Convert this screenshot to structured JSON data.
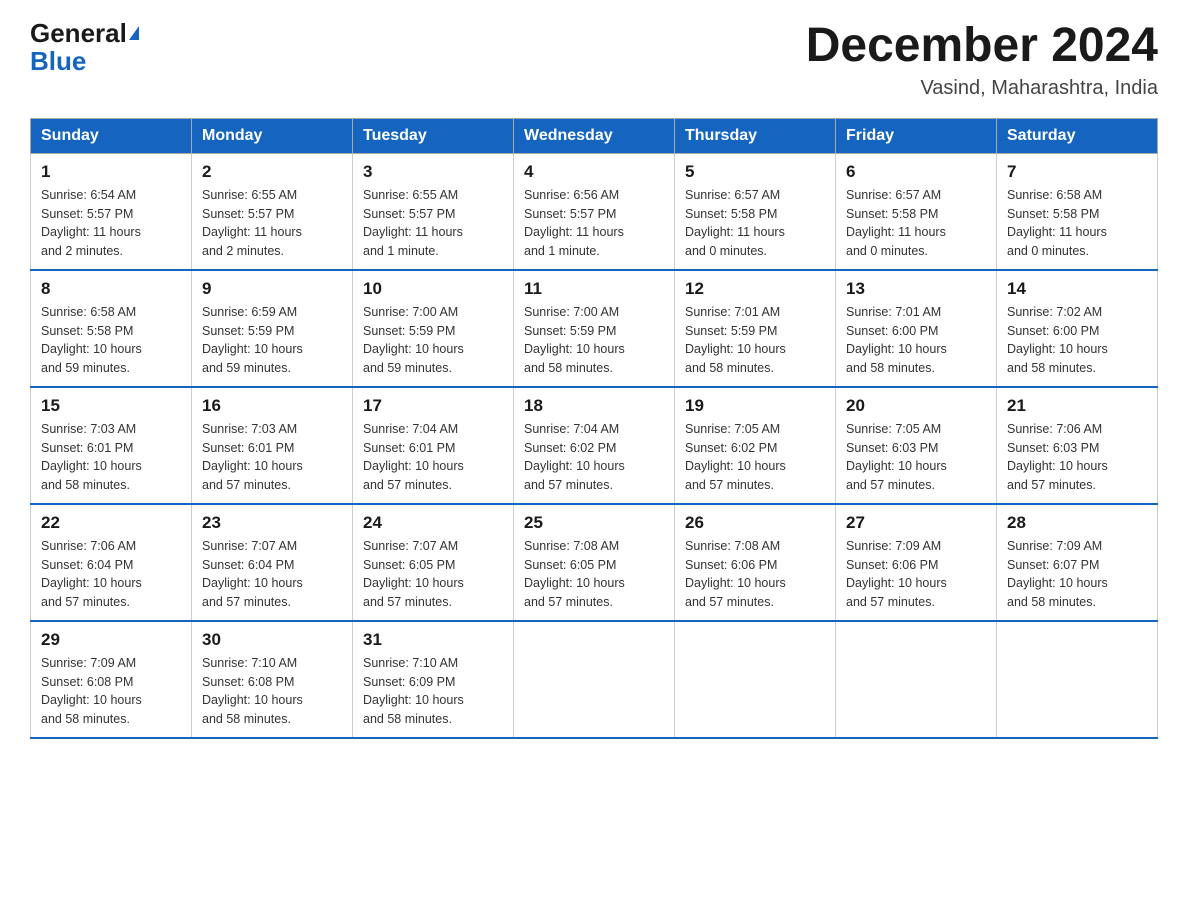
{
  "logo": {
    "line1": "General",
    "line2": "Blue"
  },
  "title": {
    "month_year": "December 2024",
    "location": "Vasind, Maharashtra, India"
  },
  "weekdays": [
    "Sunday",
    "Monday",
    "Tuesday",
    "Wednesday",
    "Thursday",
    "Friday",
    "Saturday"
  ],
  "weeks": [
    [
      {
        "day": "1",
        "info": "Sunrise: 6:54 AM\nSunset: 5:57 PM\nDaylight: 11 hours\nand 2 minutes."
      },
      {
        "day": "2",
        "info": "Sunrise: 6:55 AM\nSunset: 5:57 PM\nDaylight: 11 hours\nand 2 minutes."
      },
      {
        "day": "3",
        "info": "Sunrise: 6:55 AM\nSunset: 5:57 PM\nDaylight: 11 hours\nand 1 minute."
      },
      {
        "day": "4",
        "info": "Sunrise: 6:56 AM\nSunset: 5:57 PM\nDaylight: 11 hours\nand 1 minute."
      },
      {
        "day": "5",
        "info": "Sunrise: 6:57 AM\nSunset: 5:58 PM\nDaylight: 11 hours\nand 0 minutes."
      },
      {
        "day": "6",
        "info": "Sunrise: 6:57 AM\nSunset: 5:58 PM\nDaylight: 11 hours\nand 0 minutes."
      },
      {
        "day": "7",
        "info": "Sunrise: 6:58 AM\nSunset: 5:58 PM\nDaylight: 11 hours\nand 0 minutes."
      }
    ],
    [
      {
        "day": "8",
        "info": "Sunrise: 6:58 AM\nSunset: 5:58 PM\nDaylight: 10 hours\nand 59 minutes."
      },
      {
        "day": "9",
        "info": "Sunrise: 6:59 AM\nSunset: 5:59 PM\nDaylight: 10 hours\nand 59 minutes."
      },
      {
        "day": "10",
        "info": "Sunrise: 7:00 AM\nSunset: 5:59 PM\nDaylight: 10 hours\nand 59 minutes."
      },
      {
        "day": "11",
        "info": "Sunrise: 7:00 AM\nSunset: 5:59 PM\nDaylight: 10 hours\nand 58 minutes."
      },
      {
        "day": "12",
        "info": "Sunrise: 7:01 AM\nSunset: 5:59 PM\nDaylight: 10 hours\nand 58 minutes."
      },
      {
        "day": "13",
        "info": "Sunrise: 7:01 AM\nSunset: 6:00 PM\nDaylight: 10 hours\nand 58 minutes."
      },
      {
        "day": "14",
        "info": "Sunrise: 7:02 AM\nSunset: 6:00 PM\nDaylight: 10 hours\nand 58 minutes."
      }
    ],
    [
      {
        "day": "15",
        "info": "Sunrise: 7:03 AM\nSunset: 6:01 PM\nDaylight: 10 hours\nand 58 minutes."
      },
      {
        "day": "16",
        "info": "Sunrise: 7:03 AM\nSunset: 6:01 PM\nDaylight: 10 hours\nand 57 minutes."
      },
      {
        "day": "17",
        "info": "Sunrise: 7:04 AM\nSunset: 6:01 PM\nDaylight: 10 hours\nand 57 minutes."
      },
      {
        "day": "18",
        "info": "Sunrise: 7:04 AM\nSunset: 6:02 PM\nDaylight: 10 hours\nand 57 minutes."
      },
      {
        "day": "19",
        "info": "Sunrise: 7:05 AM\nSunset: 6:02 PM\nDaylight: 10 hours\nand 57 minutes."
      },
      {
        "day": "20",
        "info": "Sunrise: 7:05 AM\nSunset: 6:03 PM\nDaylight: 10 hours\nand 57 minutes."
      },
      {
        "day": "21",
        "info": "Sunrise: 7:06 AM\nSunset: 6:03 PM\nDaylight: 10 hours\nand 57 minutes."
      }
    ],
    [
      {
        "day": "22",
        "info": "Sunrise: 7:06 AM\nSunset: 6:04 PM\nDaylight: 10 hours\nand 57 minutes."
      },
      {
        "day": "23",
        "info": "Sunrise: 7:07 AM\nSunset: 6:04 PM\nDaylight: 10 hours\nand 57 minutes."
      },
      {
        "day": "24",
        "info": "Sunrise: 7:07 AM\nSunset: 6:05 PM\nDaylight: 10 hours\nand 57 minutes."
      },
      {
        "day": "25",
        "info": "Sunrise: 7:08 AM\nSunset: 6:05 PM\nDaylight: 10 hours\nand 57 minutes."
      },
      {
        "day": "26",
        "info": "Sunrise: 7:08 AM\nSunset: 6:06 PM\nDaylight: 10 hours\nand 57 minutes."
      },
      {
        "day": "27",
        "info": "Sunrise: 7:09 AM\nSunset: 6:06 PM\nDaylight: 10 hours\nand 57 minutes."
      },
      {
        "day": "28",
        "info": "Sunrise: 7:09 AM\nSunset: 6:07 PM\nDaylight: 10 hours\nand 58 minutes."
      }
    ],
    [
      {
        "day": "29",
        "info": "Sunrise: 7:09 AM\nSunset: 6:08 PM\nDaylight: 10 hours\nand 58 minutes."
      },
      {
        "day": "30",
        "info": "Sunrise: 7:10 AM\nSunset: 6:08 PM\nDaylight: 10 hours\nand 58 minutes."
      },
      {
        "day": "31",
        "info": "Sunrise: 7:10 AM\nSunset: 6:09 PM\nDaylight: 10 hours\nand 58 minutes."
      },
      {
        "day": "",
        "info": ""
      },
      {
        "day": "",
        "info": ""
      },
      {
        "day": "",
        "info": ""
      },
      {
        "day": "",
        "info": ""
      }
    ]
  ]
}
